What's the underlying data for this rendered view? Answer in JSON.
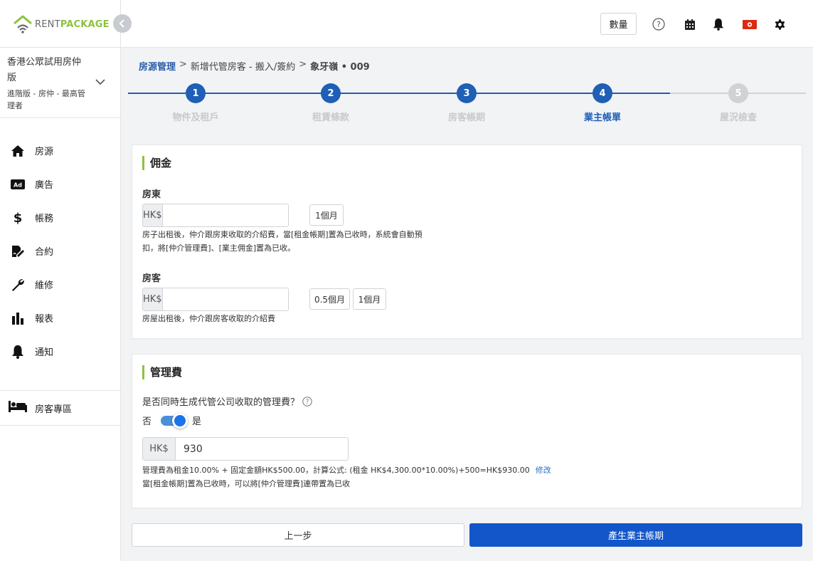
{
  "brand": {
    "rent": "RENT",
    "package": "PACKAGE",
    "accent": "#8dc23f"
  },
  "account": {
    "name": "香港公眾試用房仲版",
    "plan": "進階版 - 房仲 - 最高管理者"
  },
  "sidebar": {
    "items": [
      {
        "label": "房源",
        "icon": "home-icon"
      },
      {
        "label": "廣告",
        "icon": "ad-icon"
      },
      {
        "label": "帳務",
        "icon": "dollar-icon"
      },
      {
        "label": "合約",
        "icon": "contract-sign-icon"
      },
      {
        "label": "維修",
        "icon": "wrench-icon"
      },
      {
        "label": "報表",
        "icon": "bar-chart-icon"
      },
      {
        "label": "通知",
        "icon": "bell-icon"
      }
    ],
    "tenant_zone": {
      "label": "房客專區",
      "icon": "bed-icon"
    }
  },
  "header": {
    "quantity_label": "數量",
    "icons": [
      "help-circle-icon",
      "calendar-icon",
      "bell-icon",
      "hong-kong-flag-icon",
      "gear-icon"
    ]
  },
  "breadcrumb": {
    "root": "房源管理",
    "middle": "新增代管房客 - 搬入/簽約",
    "current": "象牙嶺 • 009",
    "separator": ">"
  },
  "stepper": {
    "active_color": "#1f5fb5",
    "inactive_color": "#d0d2d5",
    "steps": [
      {
        "number": "1",
        "label": "物件及租戶"
      },
      {
        "number": "2",
        "label": "租賃條款"
      },
      {
        "number": "3",
        "label": "房客帳期"
      },
      {
        "number": "4",
        "label": "業主帳單"
      },
      {
        "number": "5",
        "label": "屋況檢查"
      }
    ],
    "current_step": 4
  },
  "commission": {
    "title": "佣金",
    "landlord": {
      "label": "房東",
      "currency": "HK$",
      "value": "",
      "chips": [
        "1個月"
      ],
      "help_line1": "房子出租後，仲介跟房東收取的介紹費，當[租金帳期]置為已收時，系統會自動預",
      "help_line2": "扣，將[仲介管理費]、[業主佣金]置為已收。"
    },
    "tenant": {
      "label": "房客",
      "currency": "HK$",
      "value": "",
      "chips": [
        "0.5個月",
        "1個月"
      ],
      "help": "房屋出租後，仲介跟房客收取的介紹費"
    }
  },
  "management_fee": {
    "title": "管理費",
    "question": "是否同時生成代管公司收取的管理費？",
    "toggle_off": "否",
    "toggle_on": "是",
    "toggle_state": "on",
    "currency": "HK$",
    "value": "930",
    "formula": "管理費為租金10.00% + 固定金額HK$500.00，計算公式: (租金 HK$4,300.00*10.00%)+500=HK$930.00",
    "edit_label": "修改",
    "note": "當[租金帳期]置為已收時，可以將[仲介管理費]連帶置為已收"
  },
  "actions": {
    "prev_label": "上一步",
    "next_label": "產生業主帳期",
    "primary_color": "#1356c9"
  }
}
